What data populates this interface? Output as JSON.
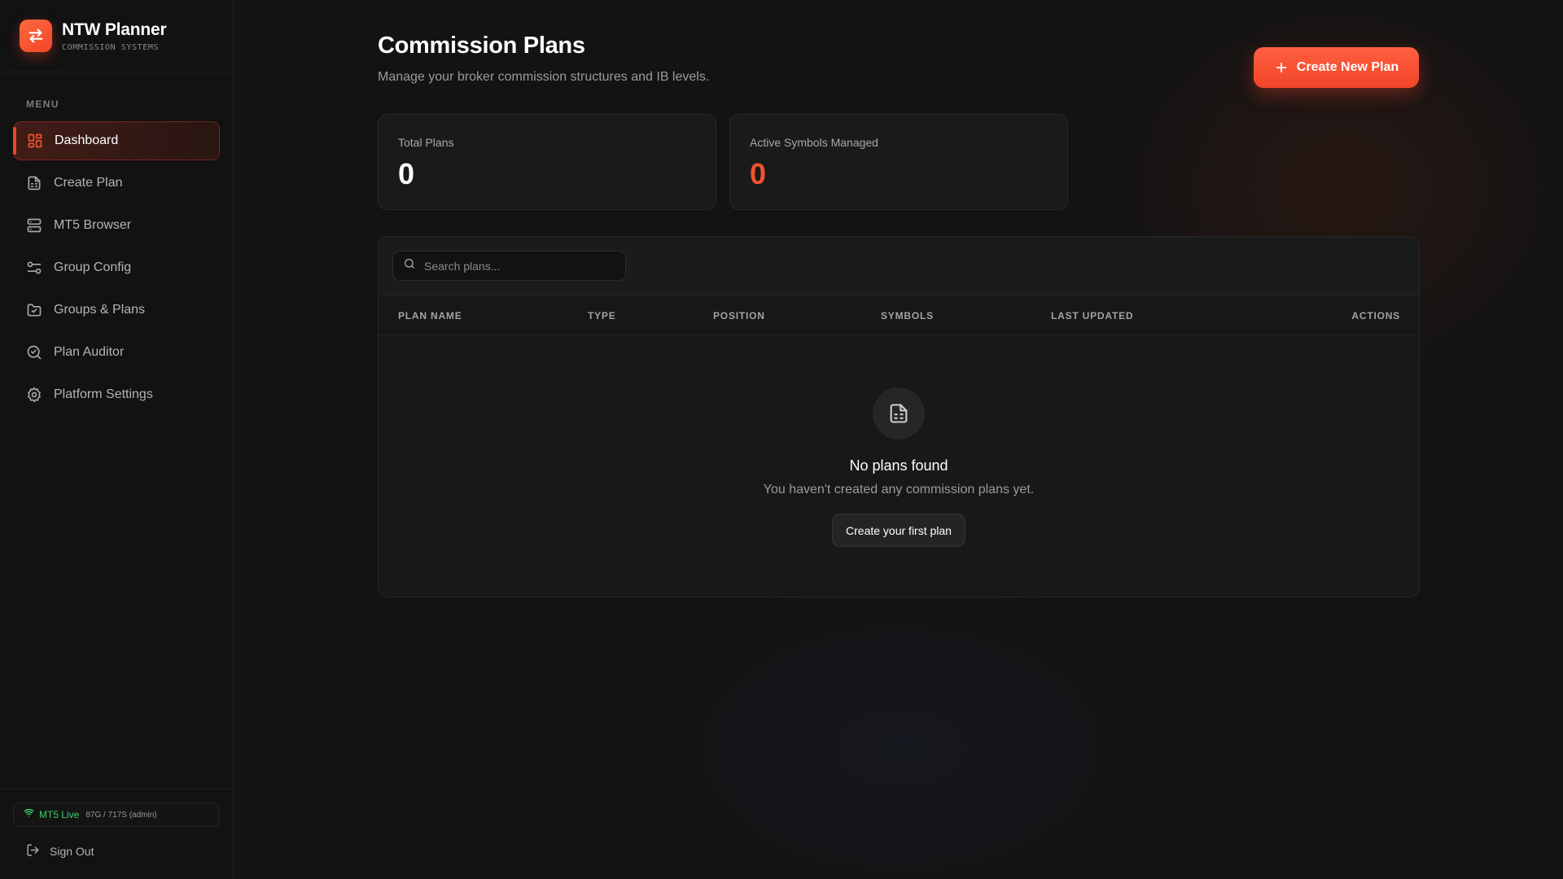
{
  "brand": {
    "title": "NTW Planner",
    "subtitle": "COMMISSION SYSTEMS",
    "logo_icon": "swap-arrows-icon"
  },
  "sidebar": {
    "menu_label": "MENU",
    "items": [
      {
        "label": "Dashboard",
        "icon": "dashboard-icon",
        "active": true
      },
      {
        "label": "Create Plan",
        "icon": "document-icon"
      },
      {
        "label": "MT5 Browser",
        "icon": "server-icon"
      },
      {
        "label": "Group Config",
        "icon": "sliders-icon"
      },
      {
        "label": "Groups & Plans",
        "icon": "folder-check-icon"
      },
      {
        "label": "Plan Auditor",
        "icon": "search-check-icon"
      },
      {
        "label": "Platform Settings",
        "icon": "gear-icon"
      }
    ],
    "status": {
      "label": "MT5 Live",
      "detail": "87G / 717S (admin)",
      "color": "#3ecf6e"
    },
    "signout_label": "Sign Out"
  },
  "page": {
    "title": "Commission Plans",
    "subtitle": "Manage your broker commission structures and IB levels.",
    "create_button_label": "Create New Plan"
  },
  "stats": [
    {
      "label": "Total Plans",
      "value": "0"
    },
    {
      "label": "Active Symbols Managed",
      "value": "0"
    }
  ],
  "table": {
    "search_placeholder": "Search plans...",
    "columns": [
      "PLAN NAME",
      "TYPE",
      "POSITION",
      "SYMBOLS",
      "LAST UPDATED",
      "ACTIONS"
    ],
    "rows": [],
    "empty": {
      "title": "No plans found",
      "subtitle": "You haven't created any commission plans yet.",
      "button_label": "Create your first plan"
    }
  },
  "colors": {
    "accent": "#f0452a",
    "background": "#131313",
    "sidebar": "#121212"
  }
}
